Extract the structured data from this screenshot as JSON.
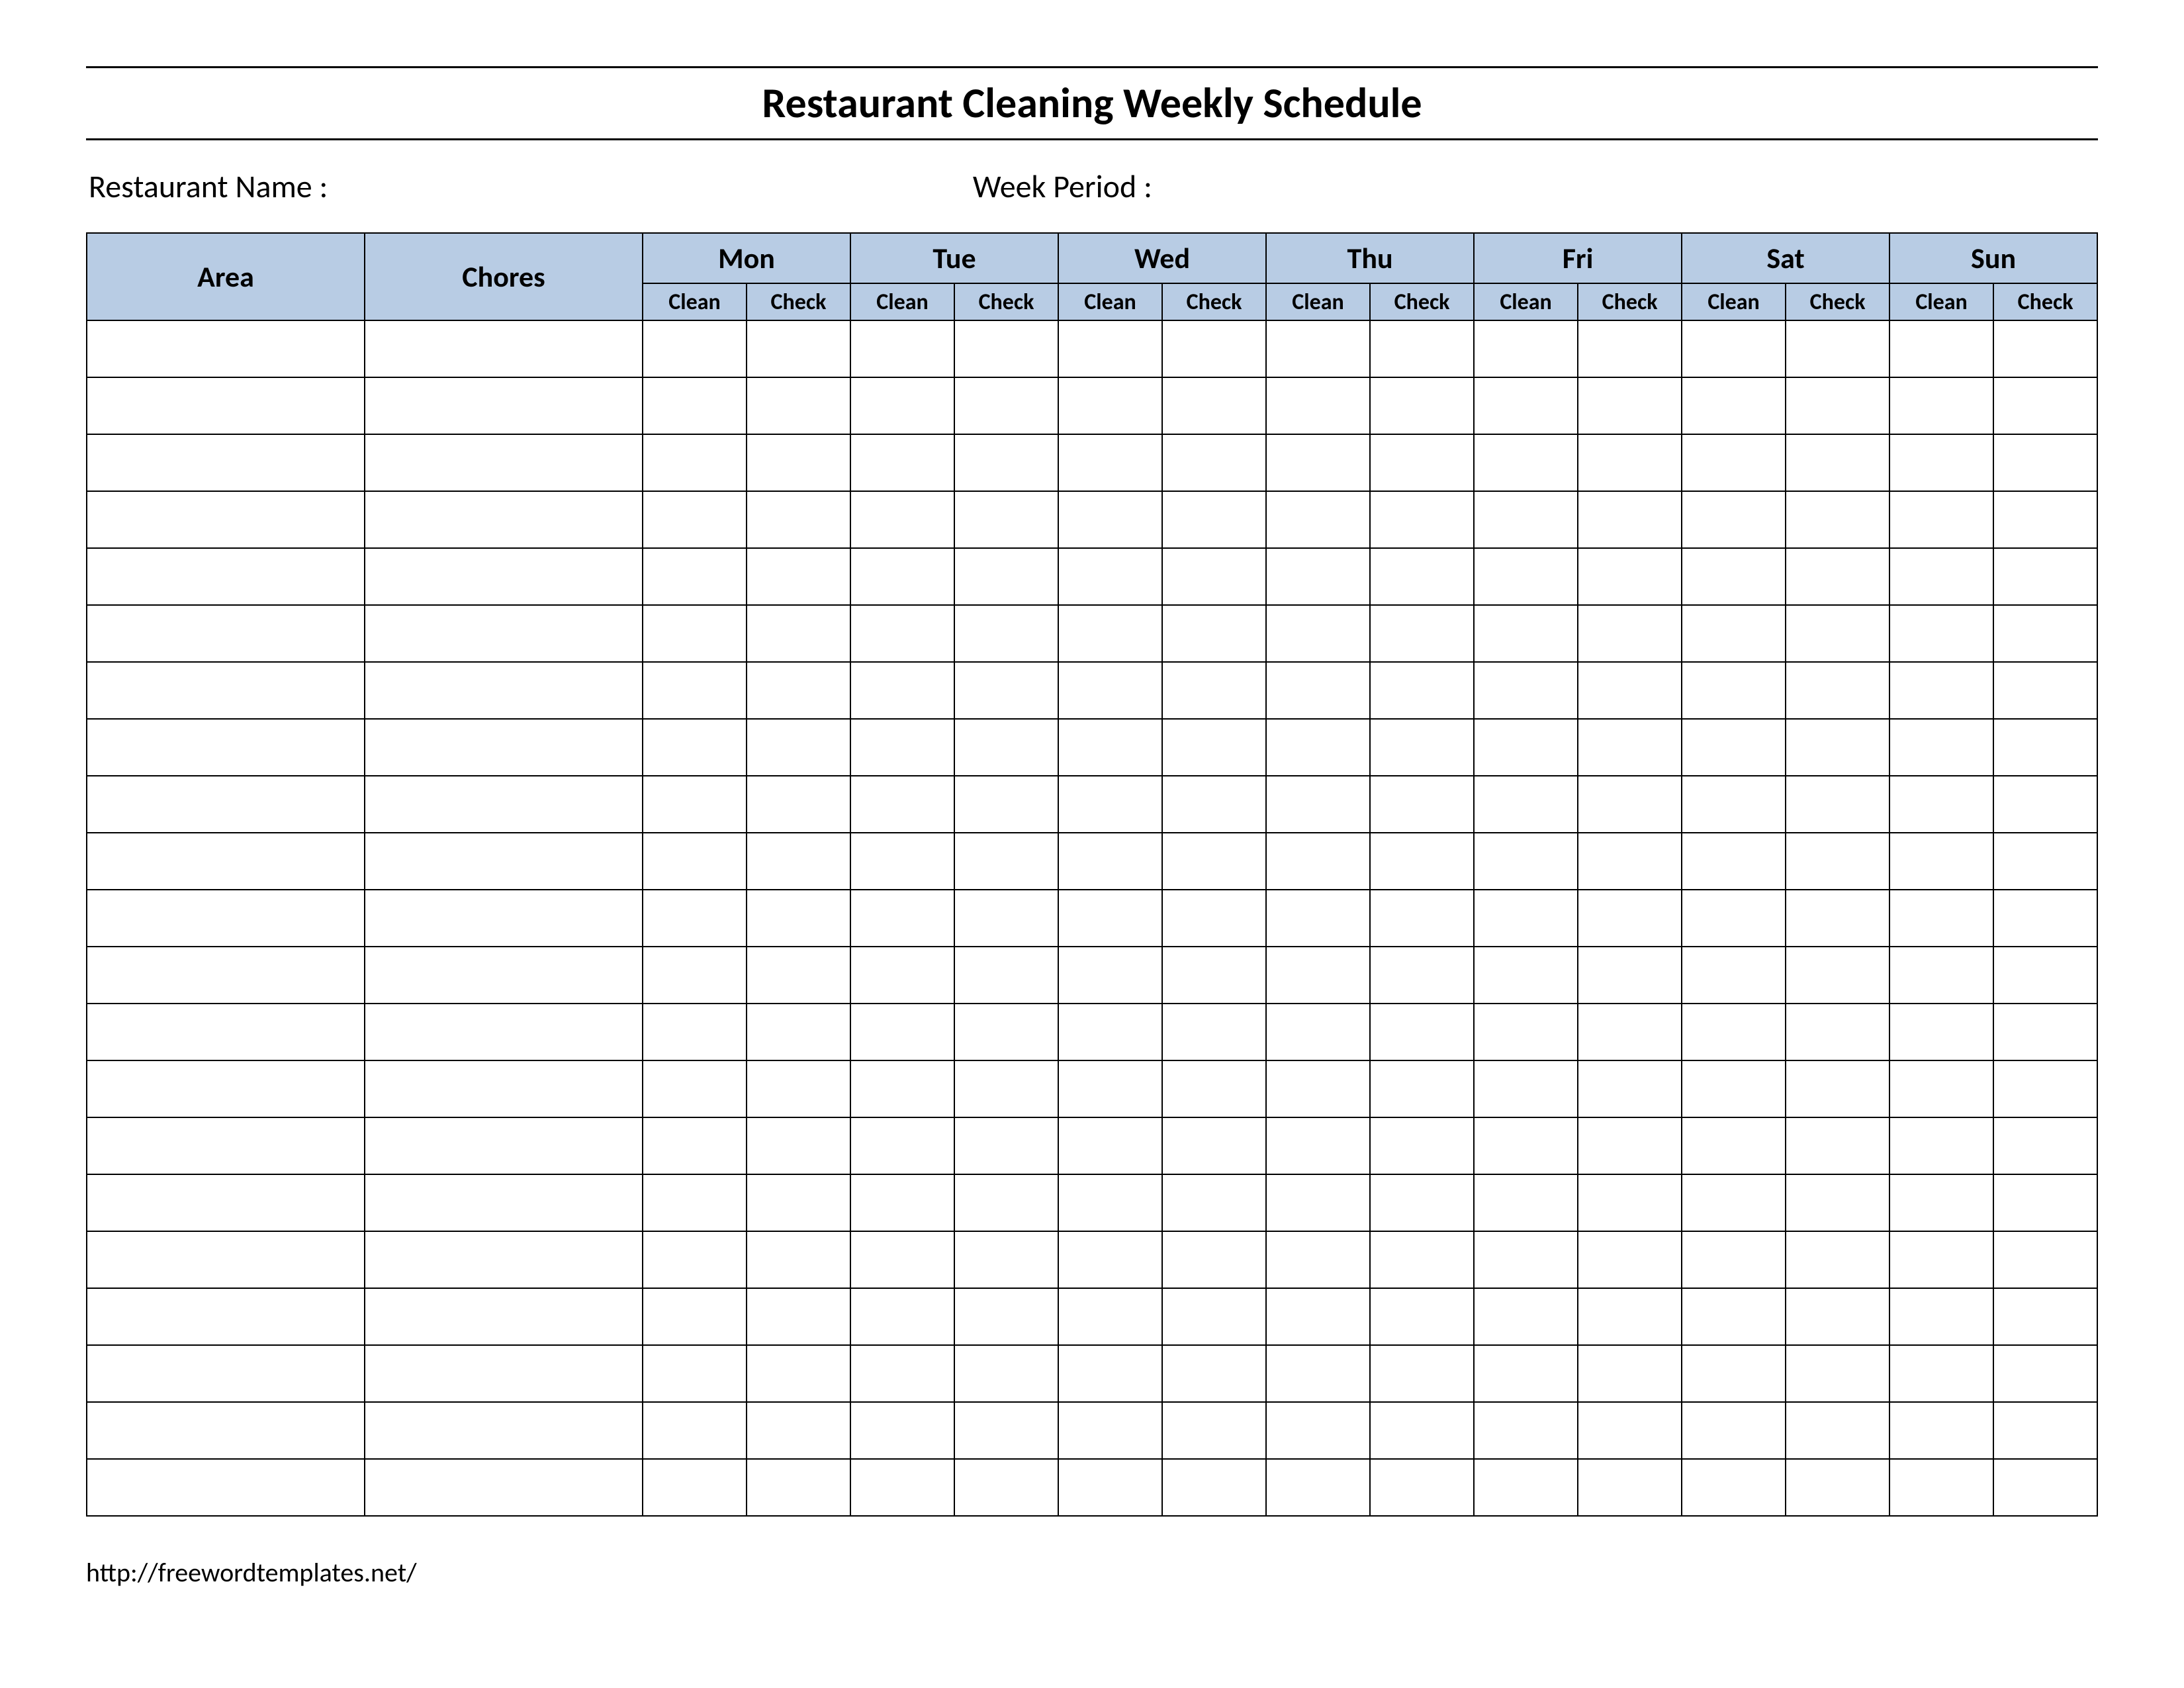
{
  "title": "Restaurant Cleaning Weekly Schedule",
  "meta": {
    "restaurant_name_label": "Restaurant Name   :",
    "week_period_label": "Week  Period :"
  },
  "columns": {
    "area": "Area",
    "chores": "Chores"
  },
  "days": [
    {
      "label": "Mon",
      "sub": [
        "Clean",
        "Check"
      ]
    },
    {
      "label": "Tue",
      "sub": [
        "Clean",
        "Check"
      ]
    },
    {
      "label": "Wed",
      "sub": [
        "Clean",
        "Check"
      ]
    },
    {
      "label": "Thu",
      "sub": [
        "Clean",
        "Check"
      ]
    },
    {
      "label": "Fri",
      "sub": [
        "Clean",
        "Check"
      ]
    },
    {
      "label": "Sat",
      "sub": [
        "Clean",
        "Check"
      ]
    },
    {
      "label": "Sun",
      "sub": [
        "Clean",
        "Check"
      ]
    }
  ],
  "body_row_count": 21,
  "footer": "http://freewordtemplates.net/",
  "colors": {
    "header_bg": "#b8cce4"
  }
}
